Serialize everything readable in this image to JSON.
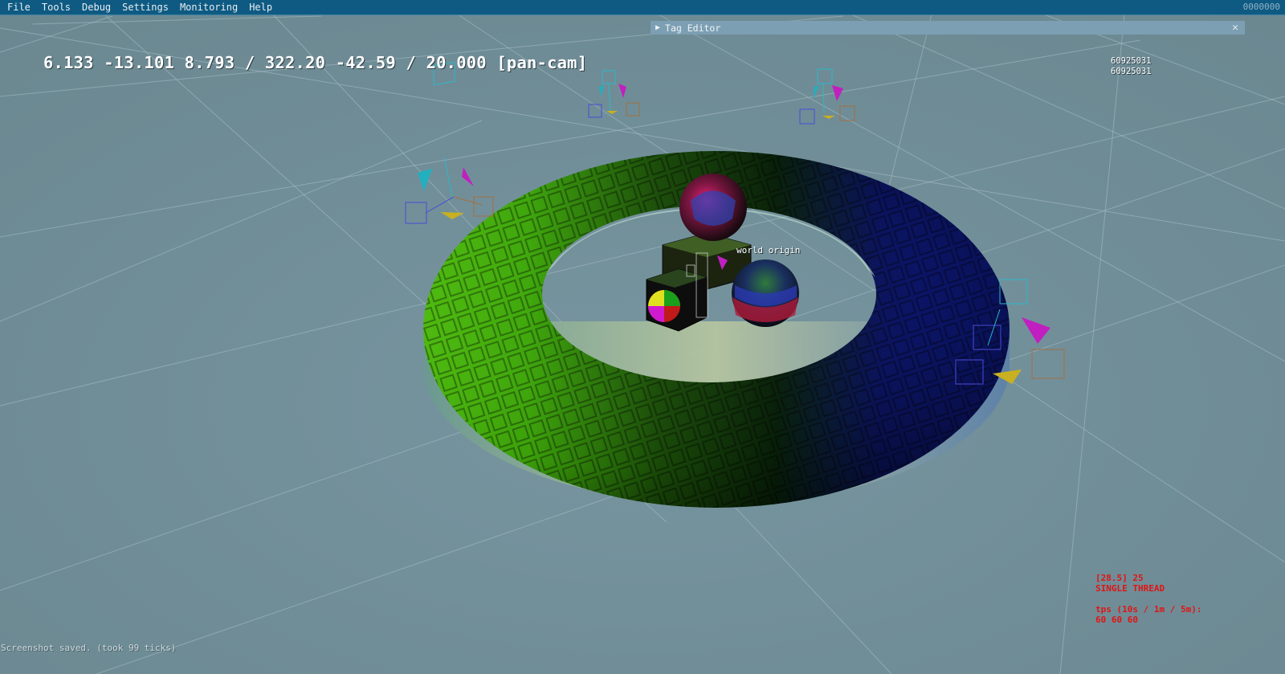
{
  "menu": {
    "items": [
      "File",
      "Tools",
      "Debug",
      "Settings",
      "Monitoring",
      "Help"
    ],
    "counter": "0000000"
  },
  "tag_editor": {
    "title": "Tag Editor",
    "close_glyph": "✕"
  },
  "hud": {
    "camera_readout": "6.133 -13.101 8.793 / 322.20 -42.59 / 20.000 [pan-cam]",
    "id_line_1": "60925031",
    "id_line_2": "60925031",
    "origin_label": "world origin"
  },
  "stats": {
    "line_1": "[28.5] 25",
    "line_2": "SINGLE THREAD",
    "line_3": "tps (10s / 1m / 5m):",
    "line_4": "60 60 60"
  },
  "status_message": "Screenshot saved. (took 99 ticks)",
  "colors": {
    "menubar": "#0e5a82",
    "background": "#6f8d96",
    "stats_text": "#e01414",
    "grid": "#a9c0c6"
  }
}
